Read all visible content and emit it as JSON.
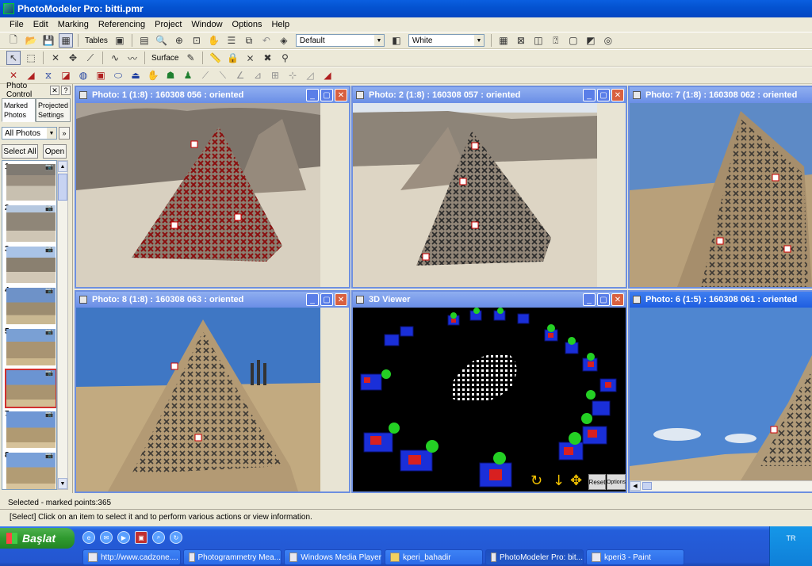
{
  "window": {
    "title": "PhotoModeler Pro: bitti.pmr"
  },
  "menu": [
    "File",
    "Edit",
    "Marking",
    "Referencing",
    "Project",
    "Window",
    "Options",
    "Help"
  ],
  "toolbar1": {
    "tables_label": "Tables",
    "style_combo": "Default",
    "color_combo": "White"
  },
  "toolbar2": {
    "surface_label": "Surface"
  },
  "photo_control": {
    "title": "Photo Control",
    "tabs": [
      "Marked Photos",
      "Projected Settings"
    ],
    "filter": "All Photos",
    "select_all_label": "Select All",
    "open_label": "Open",
    "thumbs": [
      {
        "num": "1"
      },
      {
        "num": "2"
      },
      {
        "num": "3"
      },
      {
        "num": "4"
      },
      {
        "num": "5"
      },
      {
        "num": "6",
        "selected": true
      },
      {
        "num": "7"
      },
      {
        "num": "8"
      }
    ]
  },
  "windows": {
    "photo1": {
      "title": "Photo: 1 (1:8) : 160308 056 : oriented"
    },
    "photo2": {
      "title": "Photo: 2 (1:8) : 160308 057 : oriented"
    },
    "photo7": {
      "title": "Photo: 7 (1:8) : 160308 062 : oriented"
    },
    "photo8": {
      "title": "Photo: 8 (1:8) : 160308 063 : oriented"
    },
    "viewer3d": {
      "title": "3D Viewer",
      "reset_label": "Reset",
      "options_label": "Options"
    },
    "photo6": {
      "title": "Photo: 6 (1:5) : 160308 061 : oriented"
    }
  },
  "status": {
    "selection": "Selected - marked points:365",
    "hint": "[Select] Click on an item to select it and to perform various actions or view information."
  },
  "taskbar": {
    "start_label": "Başlat",
    "tasks": [
      {
        "label": "http://www.cadzone...."
      },
      {
        "label": "Photogrammetry Mea..."
      },
      {
        "label": "Windows Media Player"
      },
      {
        "label": "kperi_bahadir"
      },
      {
        "label": "PhotoModeler Pro: bit...",
        "active": true
      },
      {
        "label": "kperi3 - Paint"
      }
    ],
    "lang": "TR"
  },
  "colors": {
    "titlebar": "#0453d1",
    "mdi_caption": "#6a8ee6",
    "marker_red": "#9a1a1a",
    "marker_dark": "#2a2a2a"
  }
}
